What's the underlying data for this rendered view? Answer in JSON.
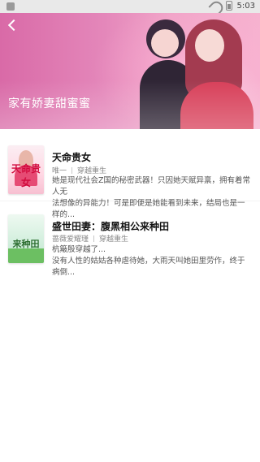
{
  "status": {
    "time": "5:03"
  },
  "banner": {
    "title": "家有娇妻甜蜜蜜"
  },
  "books": [
    {
      "title": "天命贵女",
      "cover_text": "天命贵女",
      "author": "唯一",
      "category": "穿越重生",
      "desc_line1": "她是现代社会Z国的秘密武器！只因她天赋异禀，拥有着常人无",
      "desc_line2": "法想像的异能力！可是即便是她能看到未来，结局也是一样的..."
    },
    {
      "title": "盛世田妻：腹黑相公来种田",
      "cover_text": "来种田",
      "author": "蔷薇爱耀瑾",
      "category": "穿越重生",
      "desc_line1": "杭簸殷穿越了...",
      "desc_line2": "没有人性的姑姑各种虐待她，大雨天叫她田里劳作，终于病倒..."
    }
  ]
}
